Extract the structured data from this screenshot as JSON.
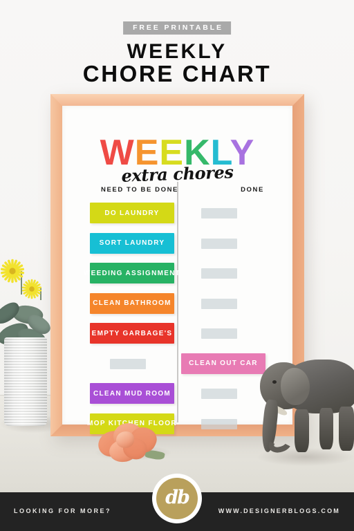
{
  "header": {
    "badge": "FREE PRINTABLE",
    "title_line1": "WEEKLY",
    "title_line2": "CHORE CHART"
  },
  "poster": {
    "title_letters": [
      {
        "char": "W",
        "color": "#ef4b45"
      },
      {
        "char": "E",
        "color": "#f5942f"
      },
      {
        "char": "E",
        "color": "#d7dc1f"
      },
      {
        "char": "K",
        "color": "#35b96a"
      },
      {
        "char": "L",
        "color": "#25bcd1"
      },
      {
        "char": "Y",
        "color": "#a872e0"
      }
    ],
    "script_subtitle": "extra chores",
    "column_headers": {
      "left": "NEED TO BE DONE",
      "right": "DONE"
    },
    "blank_color": "#ccd4d8",
    "rows": [
      {
        "left": {
          "type": "bar",
          "label": "DO LAUNDRY",
          "color": "#d4d916"
        },
        "right": {
          "type": "blank"
        }
      },
      {
        "left": {
          "type": "bar",
          "label": "SORT LAUNDRY",
          "color": "#17bfd4"
        },
        "right": {
          "type": "blank"
        }
      },
      {
        "left": {
          "type": "bar",
          "label": "WEEDING ASSIGNMENT",
          "color": "#27b264"
        },
        "right": {
          "type": "blank"
        }
      },
      {
        "left": {
          "type": "bar",
          "label": "CLEAN BATHROOM",
          "color": "#f5852b"
        },
        "right": {
          "type": "blank"
        }
      },
      {
        "left": {
          "type": "bar",
          "label": "EMPTY GARBAGE'S",
          "color": "#e8342a"
        },
        "right": {
          "type": "blank"
        }
      },
      {
        "left": {
          "type": "blank"
        },
        "right": {
          "type": "bar",
          "label": "CLEAN OUT CAR",
          "color": "#e87bb4"
        }
      },
      {
        "left": {
          "type": "bar",
          "label": "CLEAN MUD ROOM",
          "color": "#a94fd6"
        },
        "right": {
          "type": "blank"
        }
      },
      {
        "left": {
          "type": "bar",
          "label": "MOP KITCHEN FLOOR",
          "color": "#d4d916"
        },
        "right": {
          "type": "blank"
        }
      }
    ]
  },
  "scene": {
    "frame_color": "#f2b991",
    "vase_label": "white ribbed vase",
    "flower_label": "yellow daisies",
    "figurine_label": "gray elephant figurine",
    "rose_label": "peach rose bloom"
  },
  "footer": {
    "left_text": "LOOKING FOR MORE?",
    "right_text": "WWW.DESIGNERBLOGS.COM",
    "logo_text": "db",
    "logo_color": "#b9a05c"
  }
}
